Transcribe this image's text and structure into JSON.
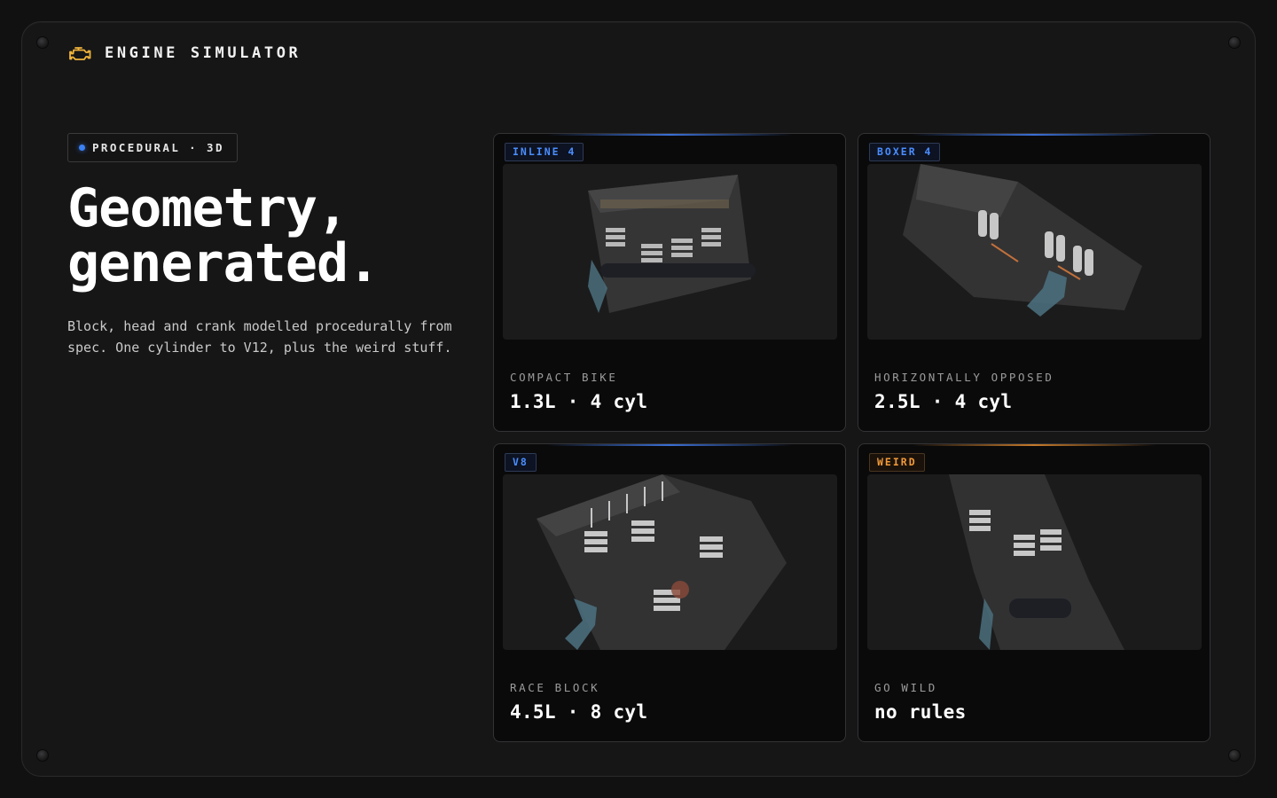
{
  "app": {
    "title": "ENGINE SIMULATOR",
    "logo_icon": "engine-check-icon",
    "logo_color": "#f0b43c"
  },
  "badge": {
    "label": "PROCEDURAL · 3D",
    "dot_color": "#3b82f6"
  },
  "hero": {
    "line1": "Geometry,",
    "line2": "generated.",
    "description": "Block, head and crank modelled procedurally from spec. One cylinder to V12, plus the weird stuff."
  },
  "cards": [
    {
      "tag": "INLINE 4",
      "tag_color": "blue",
      "subtitle": "COMPACT BIKE",
      "spec": "1.3L · 4 cyl"
    },
    {
      "tag": "BOXER 4",
      "tag_color": "blue",
      "subtitle": "HORIZONTALLY OPPOSED",
      "spec": "2.5L · 4 cyl"
    },
    {
      "tag": "V8",
      "tag_color": "blue",
      "subtitle": "RACE BLOCK",
      "spec": "4.5L · 8 cyl"
    },
    {
      "tag": "WEIRD",
      "tag_color": "orange",
      "subtitle": "GO WILD",
      "spec": "no rules"
    }
  ],
  "colors": {
    "accent_blue": "#4a8dff",
    "accent_orange": "#f29a3a",
    "background": "#111112"
  }
}
